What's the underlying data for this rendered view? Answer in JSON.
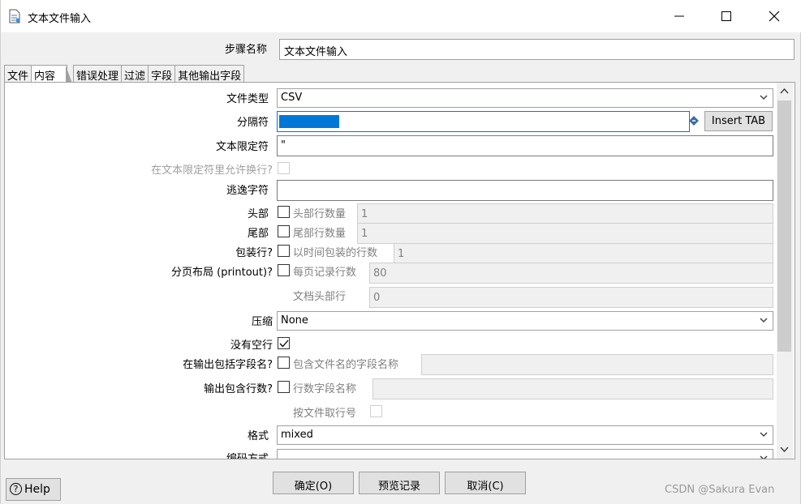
{
  "window": {
    "title": "文本文件输入",
    "step_name_label": "步骤名称",
    "step_name_value": "文本文件输入"
  },
  "tabs": [
    "文件",
    "内容",
    "错误处理",
    "过滤",
    "字段",
    "其他输出字段"
  ],
  "active_tab": "内容",
  "content": {
    "file_type": {
      "label": "文件类型",
      "value": "CSV"
    },
    "separator": {
      "label": "分隔符",
      "insert_tab": "Insert TAB",
      "selected": true
    },
    "enclosure": {
      "label": "文本限定符",
      "value": "\""
    },
    "allow_breaks": {
      "label": "在文本限定符里允许换行?"
    },
    "escape": {
      "label": "逃逸字符",
      "value": ""
    },
    "header": {
      "label": "头部",
      "sub_label": "头部行数量",
      "value": "1",
      "checked": false
    },
    "footer": {
      "label": "尾部",
      "sub_label": "尾部行数量",
      "value": "1",
      "checked": false
    },
    "wrapped": {
      "label": "包装行?",
      "sub_label": "以时间包装的行数",
      "value": "1",
      "checked": false
    },
    "paged": {
      "label": "分页布局 (printout)?",
      "sub_label": "每页记录行数",
      "value": "80",
      "checked": false
    },
    "doc_header": {
      "sub_label": "文档头部行",
      "value": "0"
    },
    "compression": {
      "label": "压缩",
      "value": "None"
    },
    "no_empty": {
      "label": "没有空行",
      "checked": true
    },
    "include_filename": {
      "label": "在输出包括字段名?",
      "sub_label": "包含文件名的字段名称",
      "value": ""
    },
    "rownum": {
      "label": "输出包含行数?",
      "sub_label": "行数字段名称",
      "value": ""
    },
    "rownum_by_file": {
      "sub_label": "按文件取行号"
    },
    "format": {
      "label": "格式",
      "value": "mixed"
    },
    "encoding": {
      "label": "编码方式",
      "value": ""
    }
  },
  "buttons": {
    "ok": "确定(O)",
    "preview": "预览记录",
    "cancel": "取消(C)",
    "help": "Help"
  },
  "watermark": "CSDN @Sakura Evan",
  "colors": {
    "selection": "#0078d7",
    "focus_border": "#0078d7",
    "disabled_text": "#a0a0a0"
  }
}
